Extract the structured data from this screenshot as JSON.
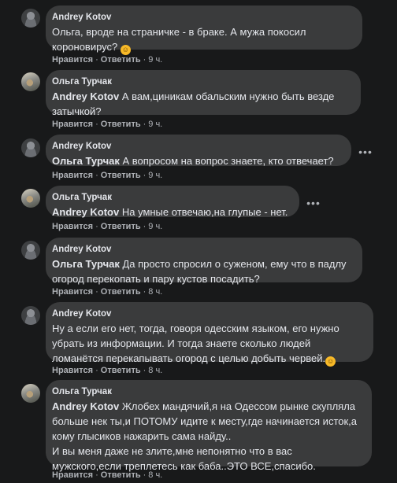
{
  "comments": [
    {
      "author": "Andrey Kotov",
      "mention": "",
      "text": "Ольга, вроде на страничке - в браке. А мужа покосил короновирус?",
      "emoji": "smile",
      "like": "Нравится",
      "reply": "Ответить",
      "time": "9 ч."
    },
    {
      "author": "Ольга Турчак",
      "mention": "Andrey Kotov",
      "text": "А вам,циникам обальским нужно быть везде затычкой?",
      "like": "Нравится",
      "reply": "Ответить",
      "time": "9 ч."
    },
    {
      "author": "Andrey Kotov",
      "mention": "Ольга Турчак",
      "text": "А вопросом на вопрос знаете, кто отвечает?",
      "like": "Нравится",
      "reply": "Ответить",
      "time": "9 ч."
    },
    {
      "author": "Ольга Турчак",
      "mention": "Andrey Kotov",
      "text": "На умные отвечаю,на глупые - нет.",
      "like": "Нравится",
      "reply": "Ответить",
      "time": "9 ч."
    },
    {
      "author": "Andrey Kotov",
      "mention": "Ольга Турчак",
      "text": "Да просто спросил о суженом, ему что в падлу огород перекопать и пару кустов посадить?",
      "like": "Нравится",
      "reply": "Ответить",
      "time": "8 ч."
    },
    {
      "author": "Andrey Kotov",
      "mention": "",
      "text": "Ну а если его нет, тогда, говоря одесским языком, его нужно убрать из информации. И тогда знаете сколько людей ломанётся перекапывать огород с целью добыть червей.",
      "emoji": "grin",
      "like": "Нравится",
      "reply": "Ответить",
      "time": "8 ч."
    },
    {
      "author": "Ольга Турчак",
      "mention": "Andrey Kotov",
      "text": "Жлобех мандячий,я на Одессом рынке скупляла больше нек ты,и ПОТОМУ идите к месту,где начинается исток,а кому глысиков нажарить сама найду..",
      "text2": "И вы меня даже не злите,мне непонятно что в вас мужского,если треплетесь как баба..ЭТО ВСЕ,спасибо.",
      "like": "Нравится",
      "reply": "Ответить",
      "time": "8 ч."
    }
  ]
}
